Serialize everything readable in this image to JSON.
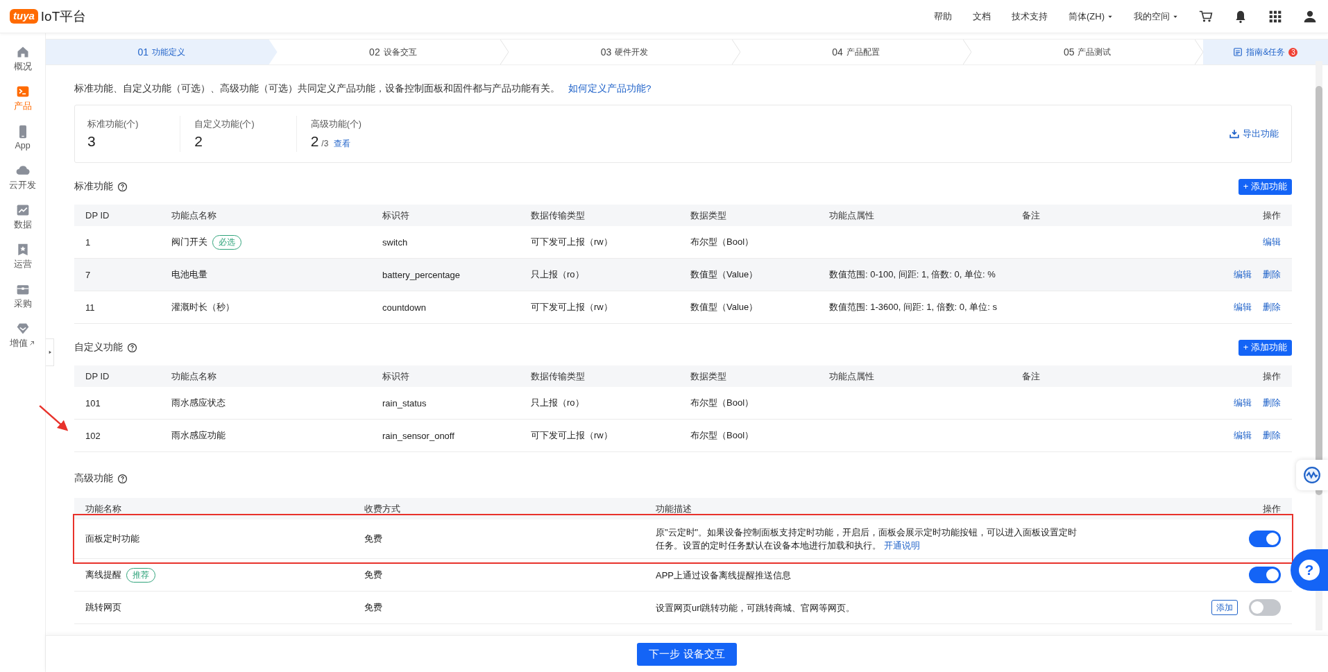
{
  "topbar": {
    "logo": "tuya",
    "title": "IoT平台",
    "nav": [
      {
        "label": "帮助",
        "dropdown": false
      },
      {
        "label": "文档",
        "dropdown": false
      },
      {
        "label": "技术支持",
        "dropdown": false
      },
      {
        "label": "简体(ZH)",
        "dropdown": true
      },
      {
        "label": "我的空间",
        "dropdown": true
      }
    ]
  },
  "sidebar": {
    "items": [
      {
        "label": "概况",
        "selected": false,
        "external": false
      },
      {
        "label": "产品",
        "selected": true,
        "external": false
      },
      {
        "label": "App",
        "selected": false,
        "external": false
      },
      {
        "label": "云开发",
        "selected": false,
        "external": false
      },
      {
        "label": "数据",
        "selected": false,
        "external": false
      },
      {
        "label": "运营",
        "selected": false,
        "external": false
      },
      {
        "label": "采购",
        "selected": false,
        "external": false
      },
      {
        "label": "增值",
        "selected": false,
        "external": true
      }
    ]
  },
  "steps": [
    {
      "number": "01",
      "label": "功能定义",
      "selected": true
    },
    {
      "number": "02",
      "label": "设备交互",
      "selected": false
    },
    {
      "number": "03",
      "label": "硬件开发",
      "selected": false
    },
    {
      "number": "04",
      "label": "产品配置",
      "selected": false
    },
    {
      "number": "05",
      "label": "产品测试",
      "selected": false
    }
  ],
  "guide": {
    "label": "指南&任务",
    "badge": "3"
  },
  "intro": {
    "text": "标准功能、自定义功能（可选）、高级功能（可选）共同定义产品功能，设备控制面板和固件都与产品功能有关。",
    "link": "如何定义产品功能?"
  },
  "stats": {
    "items": [
      {
        "label": "标准功能(个)",
        "value": "3"
      },
      {
        "label": "自定义功能(个)",
        "value": "2"
      },
      {
        "label": "高级功能(个)",
        "value": "2",
        "total": "/3",
        "link": "查看"
      }
    ],
    "export": "导出功能"
  },
  "standard": {
    "title": "标准功能",
    "add_button": "+ 添加功能",
    "columns": [
      "DP ID",
      "功能点名称",
      "标识符",
      "数据传输类型",
      "数据类型",
      "功能点属性",
      "备注",
      "操作"
    ],
    "rows": [
      {
        "id": "1",
        "name": "阀门开关",
        "tag": "必选",
        "identifier": "switch",
        "transfer": "可下发可上报（rw）",
        "type": "布尔型（Bool）",
        "properties": "",
        "actions": [
          "编辑"
        ]
      },
      {
        "id": "7",
        "name": "电池电量",
        "identifier": "battery_percentage",
        "transfer": "只上报（ro）",
        "type": "数值型（Value）",
        "properties": "数值范围: 0-100, 间距: 1, 倍数: 0, 单位: %",
        "actions": [
          "编辑",
          "删除"
        ]
      },
      {
        "id": "11",
        "name": "灌溉时长（秒）",
        "identifier": "countdown",
        "transfer": "可下发可上报（rw）",
        "type": "数值型（Value）",
        "properties": "数值范围: 1-3600, 间距: 1, 倍数: 0, 单位: s",
        "actions": [
          "编辑",
          "删除"
        ]
      }
    ]
  },
  "custom": {
    "title": "自定义功能",
    "add_button": "+ 添加功能",
    "columns": [
      "DP ID",
      "功能点名称",
      "标识符",
      "数据传输类型",
      "数据类型",
      "功能点属性",
      "备注",
      "操作"
    ],
    "rows": [
      {
        "id": "101",
        "name": "雨水感应状态",
        "identifier": "rain_status",
        "transfer": "只上报（ro）",
        "type": "布尔型（Bool）",
        "properties": "",
        "actions": [
          "编辑",
          "删除"
        ]
      },
      {
        "id": "102",
        "name": "雨水感应功能",
        "identifier": "rain_sensor_onoff",
        "transfer": "可下发可上报（rw）",
        "type": "布尔型（Bool）",
        "properties": "",
        "actions": [
          "编辑",
          "删除"
        ]
      }
    ]
  },
  "advanced": {
    "title": "高级功能",
    "columns": [
      "功能名称",
      "收费方式",
      "功能描述",
      "操作"
    ],
    "rows": [
      {
        "name": "面板定时功能",
        "fee": "免费",
        "description": "原\"云定时\"。如果设备控制面板支持定时功能，开启后，面板会展示定时功能按钮，可以进入面板设置定时任务。设置的定时任务默认在设备本地进行加载和执行。",
        "link": "开通说明",
        "on": true,
        "highlighted": true
      },
      {
        "name": "离线提醒",
        "tag": "推荐",
        "fee": "免费",
        "description": "APP上通过设备离线提醒推送信息",
        "on": true,
        "highlighted": false
      },
      {
        "name": "跳转网页",
        "fee": "免费",
        "description": "设置网页url跳转功能，可跳转商城、官网等网页。",
        "button": "添加",
        "on": false,
        "highlighted": false
      }
    ]
  },
  "footer": {
    "next_button": "下一步 设备交互"
  },
  "help": {
    "label": "?"
  }
}
